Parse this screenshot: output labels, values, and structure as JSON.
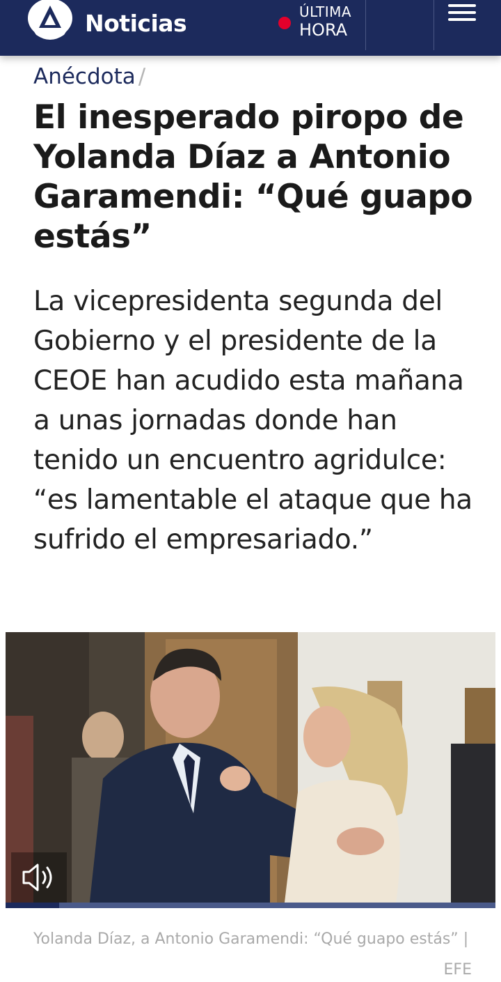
{
  "header": {
    "brand": "Noticias",
    "live_line1": "ÚLTIMA",
    "live_line2": "HORA",
    "colors": {
      "background": "#1c2a5c",
      "live_dot": "#e4002b"
    },
    "menu_icon": "hamburger-icon"
  },
  "article": {
    "category": "Anécdota",
    "separator": "/",
    "title": "El inesperado piropo de Yolanda Díaz a Antonio Garamendi: “Qué guapo estás”",
    "lead": "La vicepresidenta segunda del Gobierno y el presidente de la CEOE han acudido esta mañana a unas jornadas donde han tenido un encuentro agridulce: “es lamentable el ataque que ha sufrido el empresariado.”"
  },
  "video": {
    "volume_icon": "speaker-icon",
    "progress": 0.11,
    "caption": "Yolanda Díaz, a Antonio Garamendi: “Qué guapo estás” |",
    "credit": "EFE"
  }
}
